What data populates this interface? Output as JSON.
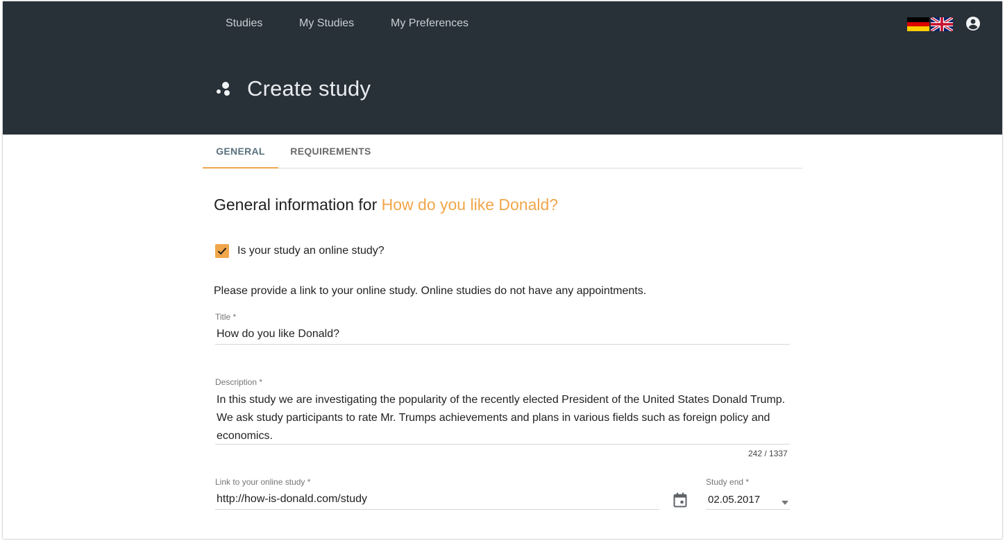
{
  "nav": {
    "items": [
      "Studies",
      "My Studies",
      "My Preferences"
    ]
  },
  "languages": [
    {
      "icon": "german-flag-icon",
      "label": "German"
    },
    {
      "icon": "uk-flag-icon",
      "label": "English"
    }
  ],
  "account_icon": "account-circle-icon",
  "page": {
    "icon": "study-logo-icon",
    "title": "Create study"
  },
  "tabs": [
    {
      "label": "GENERAL",
      "active": true
    },
    {
      "label": "REQUIREMENTS",
      "active": false
    }
  ],
  "section": {
    "heading_prefix": "General information for ",
    "heading_study": "How do you like Donald?"
  },
  "online_study": {
    "label": "Is your study an online study?",
    "checked": true
  },
  "hint": "Please provide a link to your online study. Online studies do not have any appointments.",
  "form": {
    "title": {
      "label": "Title *",
      "value": "How do you like Donald?"
    },
    "description": {
      "label": "Description *",
      "value": "In this study we are investigating the popularity of the recently elected President of the United States Donald Trump. We ask study participants to rate Mr. Trumps achievements and plans in various fields such as foreign policy and economics.",
      "counter": "242 / 1337"
    },
    "link": {
      "label": "Link to your online study *",
      "value": "http://how-is-donald.com/study"
    },
    "study_end": {
      "label": "Study end *",
      "value": "02.05.2017",
      "icon": "calendar-icon"
    }
  },
  "colors": {
    "header_bg": "#283038",
    "accent": "#f0a64a",
    "active_tab": "#59717e"
  }
}
